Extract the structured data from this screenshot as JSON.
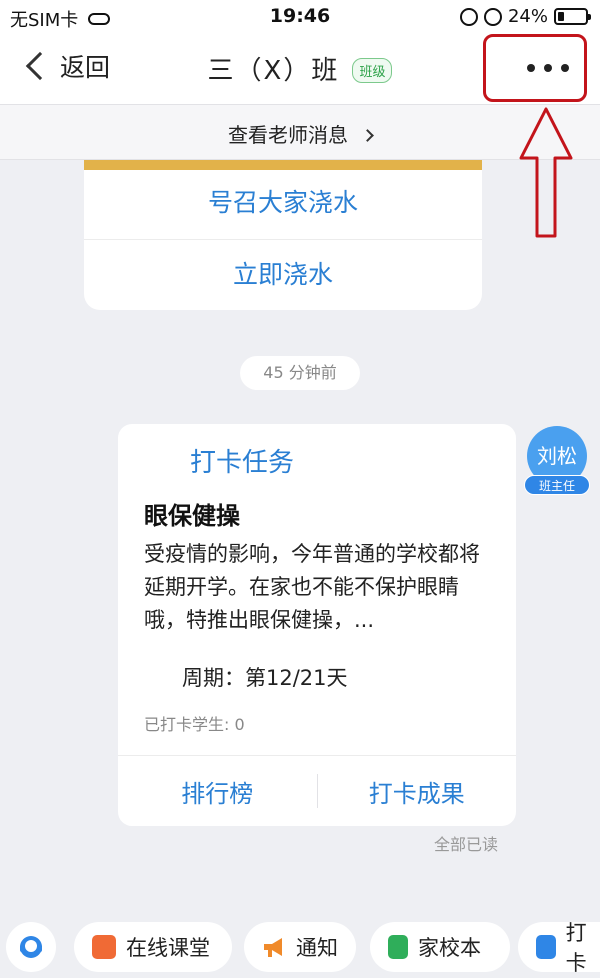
{
  "status_bar": {
    "carrier": "无SIM卡",
    "time": "19:46",
    "battery": "24%",
    "battery_level": 0.24
  },
  "nav": {
    "back_label": "返回",
    "title": "三（X）班",
    "badge": "班级"
  },
  "teacher_bar": {
    "label": "查看老师消息"
  },
  "top_card": {
    "action_1": "号召大家浇水",
    "action_2": "立即浇水"
  },
  "time_divider": "45 分钟前",
  "task_card": {
    "title": "打卡任务",
    "heading": "眼保健操",
    "description": "受疫情的影响，今年普通的学校都将延期开学。在家也不能不保护眼睛哦，特推出眼保健操，...",
    "period": "周期：第12/21天",
    "checked_students": "已打卡学生: 0",
    "ranking_label": "排行榜",
    "results_label": "打卡成果"
  },
  "sender": {
    "name": "刘松",
    "role": "班主任"
  },
  "read_status": "全部已读",
  "bottom_bar": {
    "chips": [
      {
        "label": "在线课堂",
        "icon": "classroom-icon",
        "color": "#f06a35"
      },
      {
        "label": "通知",
        "icon": "megaphone-icon",
        "color": "#f08a2a"
      },
      {
        "label": "家校本",
        "icon": "notebook-icon",
        "color": "#2fae5a"
      },
      {
        "label": "打卡",
        "icon": "checkbox-icon",
        "color": "#2f86e6"
      }
    ]
  },
  "colors": {
    "accent_blue": "#2a7fd3",
    "highlight_red": "#c3141b",
    "card_band": "#e2b24a"
  }
}
